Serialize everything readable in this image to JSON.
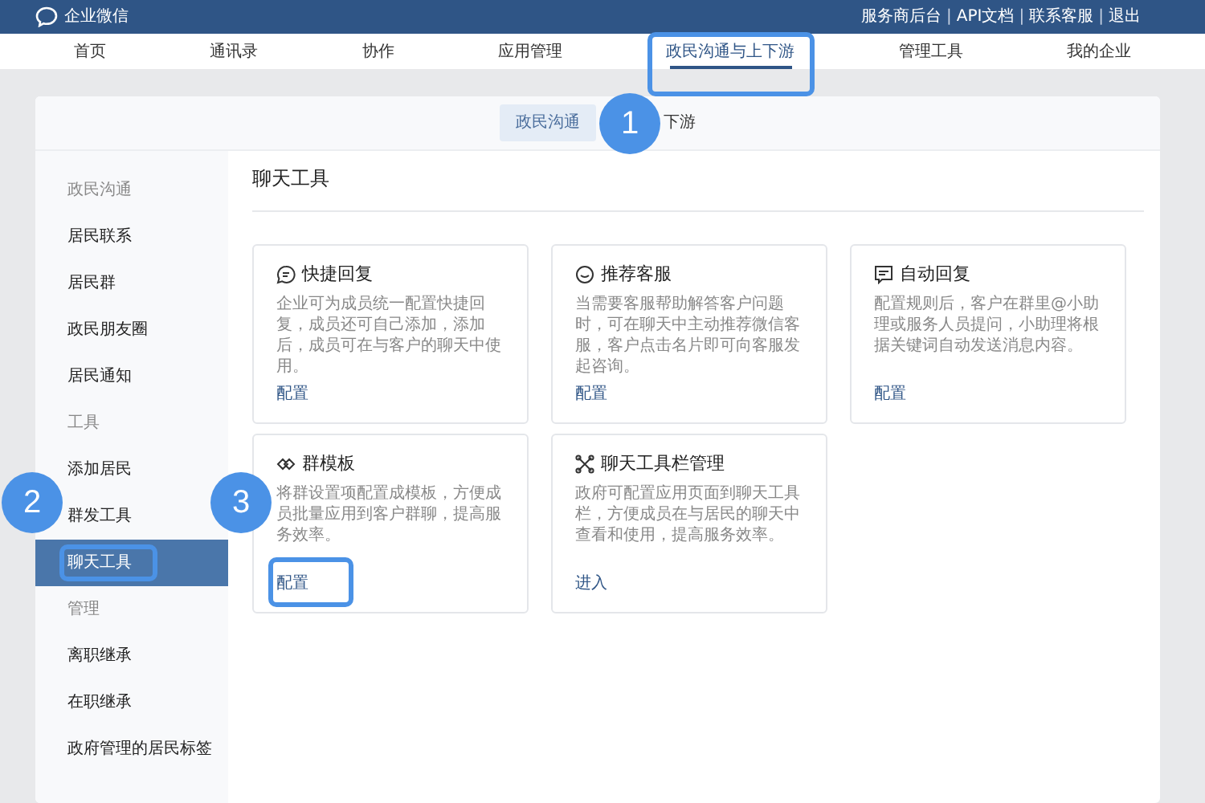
{
  "top_bar": {
    "brand": "企业微信",
    "links": [
      "服务商后台",
      "API文档",
      "联系客服",
      "退出"
    ],
    "separator": "|"
  },
  "nav": [
    {
      "label": "首页",
      "selected": false
    },
    {
      "label": "通讯录",
      "selected": false
    },
    {
      "label": "协作",
      "selected": false
    },
    {
      "label": "应用管理",
      "selected": false
    },
    {
      "label": "政民沟通与上下游",
      "selected": true
    },
    {
      "label": "管理工具",
      "selected": false
    },
    {
      "label": "我的企业",
      "selected": false
    }
  ],
  "sub_tabs": [
    {
      "label": "政民沟通",
      "selected": true
    },
    {
      "label": "下游",
      "selected": false
    }
  ],
  "sidebar": {
    "groups": [
      {
        "heading": "政民沟通",
        "items": [
          {
            "label": "居民联系",
            "selected": false
          },
          {
            "label": "居民群",
            "selected": false
          },
          {
            "label": "政民朋友圈",
            "selected": false
          },
          {
            "label": "居民通知",
            "selected": false
          }
        ]
      },
      {
        "heading": "工具",
        "items": [
          {
            "label": "添加居民",
            "selected": false
          },
          {
            "label": "群发工具",
            "selected": false
          },
          {
            "label": "聊天工具",
            "selected": true
          }
        ]
      },
      {
        "heading": "管理",
        "items": [
          {
            "label": "离职继承",
            "selected": false
          },
          {
            "label": "在职继承",
            "selected": false
          },
          {
            "label": "政府管理的居民标签",
            "selected": false
          }
        ]
      }
    ]
  },
  "content": {
    "title": "聊天工具",
    "cards": [
      {
        "kind": "reply",
        "title": "快捷回复",
        "description": "企业可为成员统一配置快捷回复，成员还可自己添加，添加后，成员可在与客户的聊天中使用。",
        "action": "配置"
      },
      {
        "kind": "service",
        "title": "推荐客服",
        "description": "当需要客服帮助解答客户问题时，可在聊天中主动推荐微信客服，客户点击名片即可向客服发起咨询。",
        "action": "配置"
      },
      {
        "kind": "auto",
        "title": "自动回复",
        "description": "配置规则后，客户在群里@小助理或服务人员提问，小助理将根据关键词自动发送消息内容。",
        "action": "配置"
      },
      {
        "kind": "template",
        "title": "群模板",
        "description": "将群设置项配置成模板，方便成员批量应用到客户群聊，提高服务效率。",
        "action": "配置"
      },
      {
        "kind": "toolbar",
        "title": "聊天工具栏管理",
        "description": "政府可配置应用页面到聊天工具栏，方便成员在与居民的聊天中查看和使用，提高服务效率。",
        "action": "进入"
      }
    ]
  },
  "annotations": [
    {
      "label": "1"
    },
    {
      "label": "2"
    },
    {
      "label": "3"
    }
  ]
}
